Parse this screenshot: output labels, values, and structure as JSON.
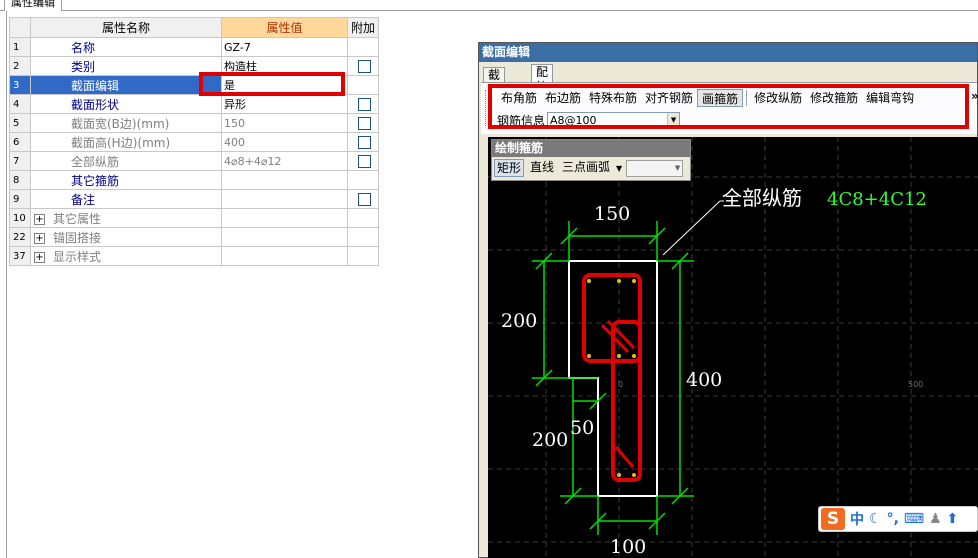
{
  "top_tab": "属性编辑",
  "grid": {
    "headers": {
      "num": "",
      "name": "属性名称",
      "value": "属性值",
      "extra": "附加"
    },
    "rows": [
      {
        "num": "1",
        "name": "名称",
        "value": "GZ-7",
        "checkbox": false
      },
      {
        "num": "2",
        "name": "类别",
        "value": "构造柱",
        "checkbox": true
      },
      {
        "num": "3",
        "name": "截面编辑",
        "value": "是",
        "checkbox": false
      },
      {
        "num": "4",
        "name": "截面形状",
        "value": "异形",
        "checkbox": true
      },
      {
        "num": "5",
        "name": "截面宽(B边)(mm)",
        "value": "150",
        "checkbox": true
      },
      {
        "num": "6",
        "name": "截面高(H边)(mm)",
        "value": "400",
        "checkbox": true
      },
      {
        "num": "7",
        "name": "全部纵筋",
        "value": "4⌀8+4⌀12",
        "checkbox": true
      },
      {
        "num": "8",
        "name": "其它箍筋",
        "value": "",
        "checkbox": false
      },
      {
        "num": "9",
        "name": "备注",
        "value": "",
        "checkbox": true
      },
      {
        "num": "10",
        "name": "其它属性",
        "value": "",
        "checkbox": false
      },
      {
        "num": "22",
        "name": "锚固搭接",
        "value": "",
        "checkbox": false
      },
      {
        "num": "37",
        "name": "显示样式",
        "value": "",
        "checkbox": false
      }
    ]
  },
  "dialog": {
    "title": "截面编辑",
    "tabs": [
      "截面",
      "配筋"
    ],
    "toolbar": [
      "布角筋",
      "布边筋",
      "特殊布筋",
      "对齐钢筋",
      "画箍筋",
      "修改纵筋",
      "修改箍筋",
      "编辑弯钩"
    ],
    "more": "»",
    "info_label": "钢筋信息",
    "info_value": "A8@100",
    "draw_panel": {
      "title": "绘制箍筋",
      "buttons": [
        "矩形",
        "直线",
        "三点画弧"
      ],
      "combo_value": ""
    }
  },
  "canvas_labels": {
    "rebar_label": "全部纵筋",
    "rebar_value": "4C8+4C12",
    "dim_top": "150",
    "dim_left_upper": "200",
    "dim_left_lower": "200",
    "dim_inner": "50",
    "dim_right": "400",
    "dim_bottom": "100",
    "axis_zero": "0",
    "axis_500": "500"
  },
  "ime": {
    "logo": "S",
    "lang": "中"
  },
  "colors": {
    "selected_row": "#3169c6",
    "value_header": "#ffd79a",
    "highlight": "#e00000",
    "dim_line": "#00e000",
    "rebar": "#e00000",
    "canvas": "#000000"
  }
}
